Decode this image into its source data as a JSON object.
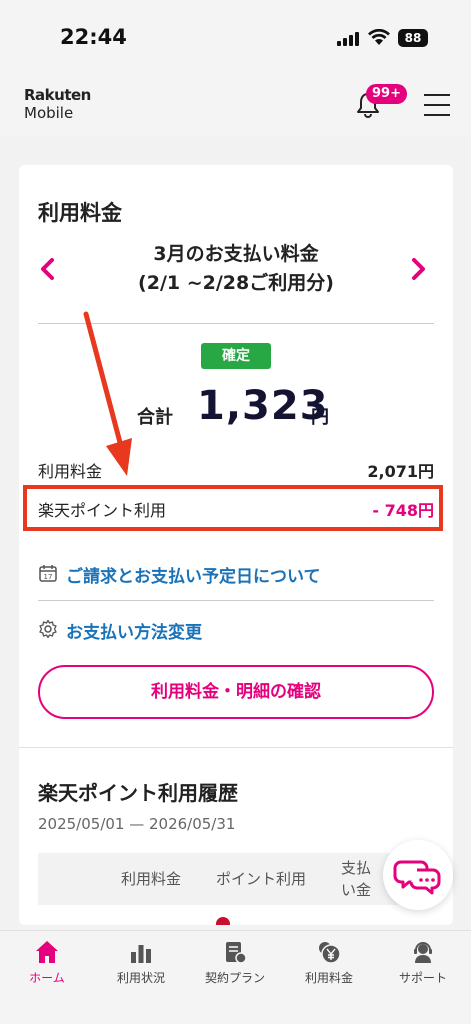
{
  "status_bar": {
    "time": "22:44",
    "battery": "88"
  },
  "header": {
    "logo_top": "Rakuten",
    "logo_bottom": "Mobile",
    "notification_badge": "99+"
  },
  "billing": {
    "title": "利用料金",
    "month_title": "3月のお支払い料金",
    "period": "(2/1 ~2/28ご利用分)",
    "status": "確定",
    "total_label": "合計",
    "total_amount": "1,323",
    "total_unit": "円",
    "rows": [
      {
        "label": "利用料金",
        "value": "2,071円"
      },
      {
        "label": "楽天ポイント利用",
        "value": "- 748円"
      }
    ],
    "links": [
      {
        "label": "ご請求とお支払い予定日について"
      },
      {
        "label": "お支払い方法変更"
      }
    ],
    "detail_button": "利用料金・明細の確認"
  },
  "points_history": {
    "title": "楽天ポイント利用履歴",
    "date_range": "2025/05/01 — 2026/05/31",
    "columns": [
      "利用料金",
      "ポイント利用",
      "支払い金"
    ]
  },
  "bottom_nav": {
    "items": [
      {
        "label": "ホーム",
        "active": true
      },
      {
        "label": "利用状況",
        "active": false
      },
      {
        "label": "契約プラン",
        "active": false
      },
      {
        "label": "利用料金",
        "active": false
      },
      {
        "label": "サポート",
        "active": false
      }
    ]
  },
  "colors": {
    "brand": "#e5007d",
    "link": "#1a72b8",
    "confirmed": "#28a745",
    "annotation": "#e8381f"
  }
}
